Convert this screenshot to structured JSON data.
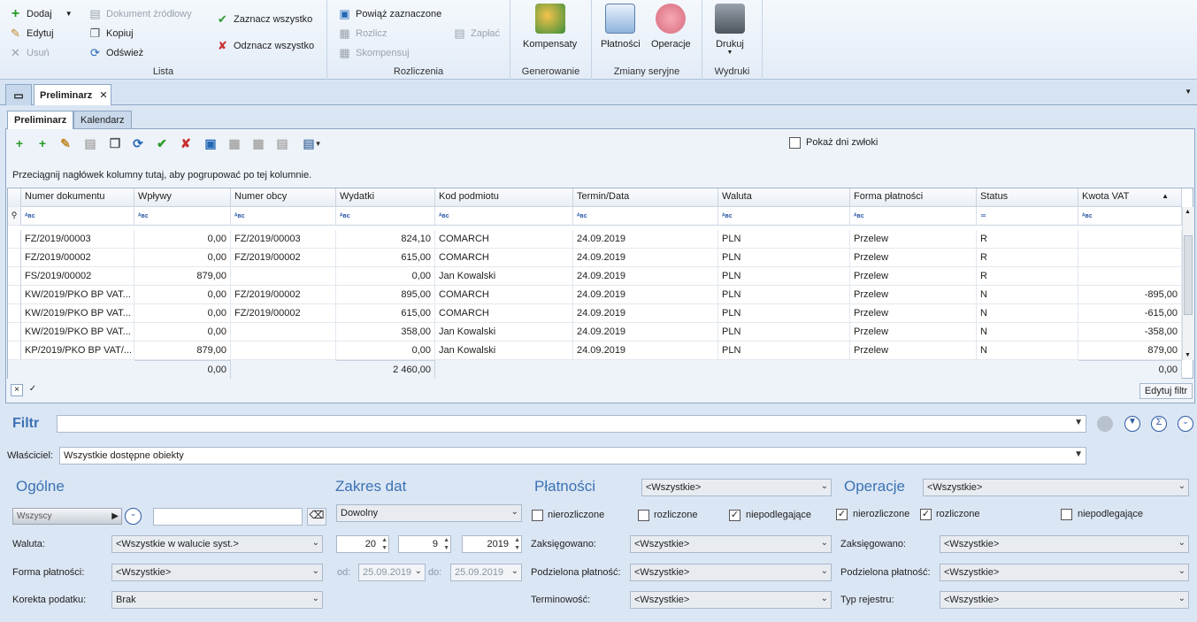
{
  "ribbon": {
    "lista": {
      "label": "Lista",
      "dodaj": "Dodaj",
      "edytuj": "Edytuj",
      "usun": "Usuń",
      "dokument": "Dokument źródłowy",
      "kopiuj": "Kopiuj",
      "odswiez": "Odśwież",
      "zaznacz": "Zaznacz wszystko",
      "odznacz": "Odznacz wszystko"
    },
    "rozliczenia": {
      "label": "Rozliczenia",
      "powiaz": "Powiąż zaznaczone",
      "rozlicz": "Rozlicz",
      "kompensuj": "Skompensuj",
      "zaplac": "Zapłać"
    },
    "generowanie": {
      "label": "Generowanie",
      "kompensaty": "Kompensaty"
    },
    "zmiany": {
      "label": "Zmiany seryjne",
      "platnosci": "Płatności",
      "operacje": "Operacje"
    },
    "wydruki": {
      "label": "Wydruki",
      "drukuj": "Drukuj"
    }
  },
  "doc_tab": {
    "title": "Preliminarz",
    "close": "✕"
  },
  "subtabs": [
    "Preliminarz",
    "Kalendarz"
  ],
  "show_delay": "Pokaż dni zwłoki",
  "group_hint": "Przeciągnij nagłówek kolumny tutaj, aby pogrupować po tej kolumnie.",
  "columns": [
    "Numer dokumentu",
    "Wpływy",
    "Numer obcy",
    "Wydatki",
    "Kod podmiotu",
    "Termin/Data",
    "Waluta",
    "Forma płatności",
    "Status",
    "Kwota VAT"
  ],
  "rows": [
    [
      "FZ/2019/00003",
      "0,00",
      "FZ/2019/00003",
      "824,10",
      "COMARCH",
      "24.09.2019",
      "PLN",
      "Przelew",
      "R",
      ""
    ],
    [
      "FZ/2019/00002",
      "0,00",
      "FZ/2019/00002",
      "615,00",
      "COMARCH",
      "24.09.2019",
      "PLN",
      "Przelew",
      "R",
      ""
    ],
    [
      "FS/2019/00002",
      "879,00",
      "",
      "0,00",
      "Jan Kowalski",
      "24.09.2019",
      "PLN",
      "Przelew",
      "R",
      ""
    ],
    [
      "KW/2019/PKO BP VAT...",
      "0,00",
      "FZ/2019/00002",
      "895,00",
      "COMARCH",
      "24.09.2019",
      "PLN",
      "Przelew",
      "N",
      "-895,00"
    ],
    [
      "KW/2019/PKO BP VAT...",
      "0,00",
      "FZ/2019/00002",
      "615,00",
      "COMARCH",
      "24.09.2019",
      "PLN",
      "Przelew",
      "N",
      "-615,00"
    ],
    [
      "KW/2019/PKO BP VAT...",
      "0,00",
      "",
      "358,00",
      "Jan Kowalski",
      "24.09.2019",
      "PLN",
      "Przelew",
      "N",
      "-358,00"
    ],
    [
      "KP/2019/PKO BP VAT/...",
      "879,00",
      "",
      "0,00",
      "Jan Kowalski",
      "24.09.2019",
      "PLN",
      "Przelew",
      "N",
      "879,00"
    ]
  ],
  "totals": {
    "wplywy": "0,00",
    "wydatki": "2 460,00",
    "vat": "0,00"
  },
  "edit_filter": "Edytuj filtr",
  "filter": {
    "label": "Filtr",
    "value": ""
  },
  "owners": {
    "label": "Właściciel:",
    "value": "Wszystkie dostępne obiekty"
  },
  "ogolne": {
    "title": "Ogólne",
    "who": "Wszyscy",
    "waluta_label": "Waluta:",
    "waluta": "<Wszystkie w walucie syst.>",
    "forma_label": "Forma płatności:",
    "forma": "<Wszystkie>",
    "korekta_label": "Korekta podatku:",
    "korekta": "Brak"
  },
  "zakres": {
    "title": "Zakres dat",
    "type": "Dowolny",
    "day": "20",
    "month": "9",
    "year": "2019",
    "od_label": "od:",
    "od": "25.09.2019",
    "do_label": "do:",
    "do": "25.09.2019"
  },
  "platnosci": {
    "title": "Płatności",
    "select": "<Wszystkie>",
    "nierozliczone": "nierozliczone",
    "rozliczone": "rozliczone",
    "niepodlegajace": "niepodlegające",
    "zaks_label": "Zaksięgowano:",
    "zaks": "<Wszystkie>",
    "podz_label": "Podzielona płatność:",
    "podz": "<Wszystkie>",
    "term_label": "Terminowość:",
    "term": "<Wszystkie>"
  },
  "operacje": {
    "title": "Operacje",
    "select": "<Wszystkie>",
    "nierozliczone": "nierozliczone",
    "rozliczone": "rozliczone",
    "niepodlegajace": "niepodlegające",
    "zaks_label": "Zaksięgowano:",
    "zaks": "<Wszystkie>",
    "podz_label": "Podzielona płatność:",
    "podz": "<Wszystkie>",
    "typ_label": "Typ rejestru:",
    "typ": "<Wszystkie>"
  }
}
